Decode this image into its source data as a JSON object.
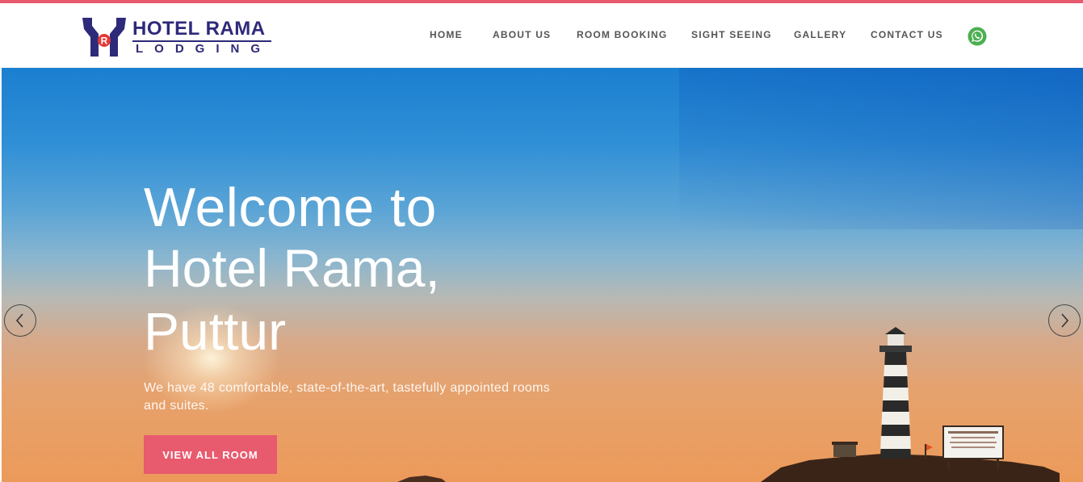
{
  "brand": {
    "line1": "HOTEL RAMA",
    "line2": "LODGING",
    "color": "#2e2a7a",
    "accent": "#e53935"
  },
  "nav": {
    "items": [
      {
        "label": "HOME"
      },
      {
        "label": "ABOUT US"
      },
      {
        "label": "ROOM BOOKING"
      },
      {
        "label": "SIGHT SEEING"
      },
      {
        "label": "GALLERY"
      },
      {
        "label": "CONTACT US"
      }
    ],
    "whatsapp_icon": "whatsapp-icon"
  },
  "hero": {
    "line1": "Welcome to",
    "line2": "Hotel Rama,",
    "line3": "Puttur",
    "subtitle": "We have 48 comfortable, state-of-the-art, tastefully appointed rooms and suites.",
    "button_label": "VIEW ALL ROOM",
    "prev_icon": "chevron-left-icon",
    "next_icon": "chevron-right-icon"
  },
  "colors": {
    "accent": "#e85a6e",
    "nav_text": "#555555",
    "whatsapp": "#4caf50"
  }
}
